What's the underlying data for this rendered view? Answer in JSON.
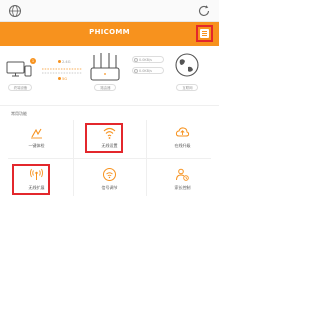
{
  "header": {
    "brand": "PHICOMM"
  },
  "status": {
    "devices_caption": "终端设备",
    "band_24": "2.4G",
    "band_5": "5G",
    "router_caption": "路由器",
    "upload_speed": "0.0KB/s",
    "download_speed": "0.0KB/s",
    "internet_caption": "互联网",
    "badge_count": "1"
  },
  "tools": {
    "title": "常用功能",
    "items": [
      {
        "label": "一键体检"
      },
      {
        "label": "无线设置"
      },
      {
        "label": "在线升级"
      },
      {
        "label": "无线扩展"
      },
      {
        "label": "信号调节"
      },
      {
        "label": "家长控制"
      }
    ]
  },
  "colors": {
    "accent": "#f7921e",
    "highlight": "#e3272c"
  }
}
